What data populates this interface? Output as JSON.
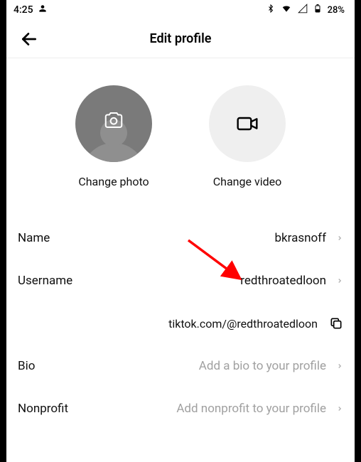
{
  "status": {
    "time": "4:25",
    "battery": "28%"
  },
  "header": {
    "title": "Edit profile"
  },
  "avatars": {
    "photo_label": "Change photo",
    "video_label": "Change video"
  },
  "rows": {
    "name": {
      "label": "Name",
      "value": "bkrasnoff"
    },
    "username": {
      "label": "Username",
      "value": "redthroatedloon"
    },
    "bio": {
      "label": "Bio",
      "placeholder": "Add a bio to your profile"
    },
    "nonprofit": {
      "label": "Nonprofit",
      "placeholder": "Add nonprofit to your profile"
    }
  },
  "profile_link": "tiktok.com/@redthroatedloon"
}
